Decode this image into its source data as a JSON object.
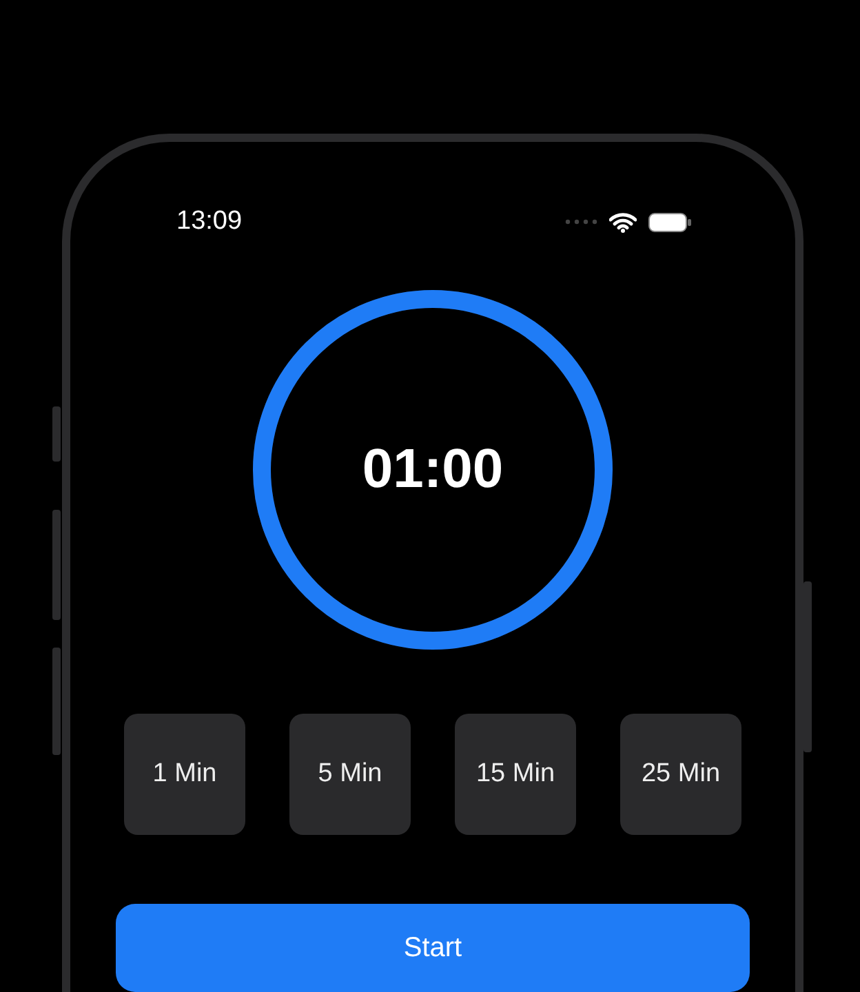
{
  "status_bar": {
    "time": "13:09"
  },
  "timer": {
    "display": "01:00",
    "level": 1
  },
  "presets": [
    {
      "label": "1 Min"
    },
    {
      "label": "5 Min"
    },
    {
      "label": "15 Min"
    },
    {
      "label": "25 Min"
    }
  ],
  "start_button": {
    "label": "Start"
  }
}
